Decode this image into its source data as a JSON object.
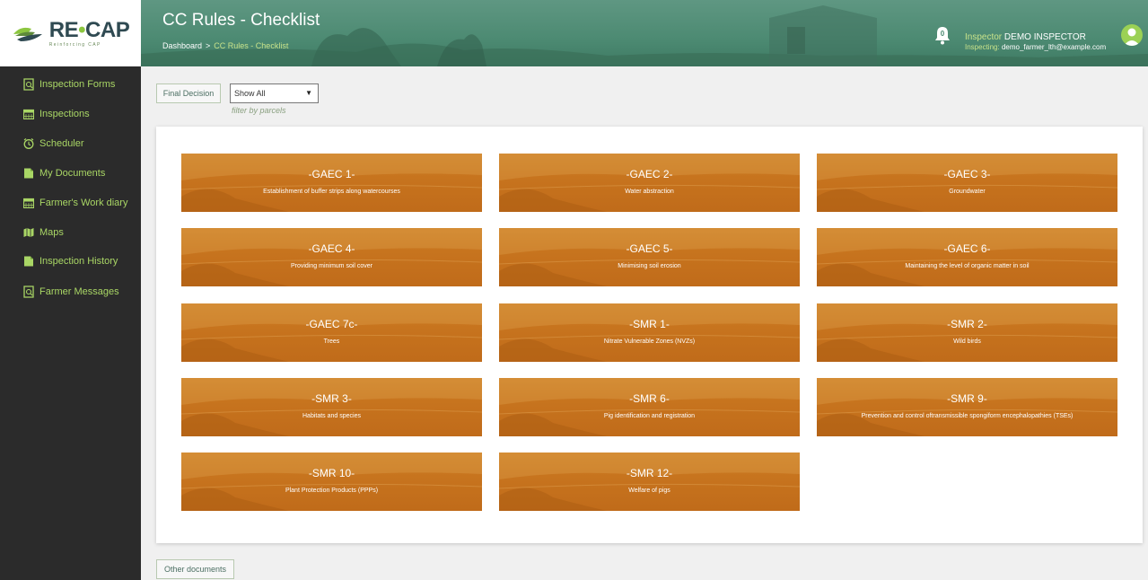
{
  "app": {
    "logo_text_main": "RE",
    "logo_text_dot": "•",
    "logo_text_end": "CAP",
    "logo_sub": "Reinforcing CAP"
  },
  "header": {
    "title": "CC Rules - Checklist",
    "breadcrumb": {
      "root": "Dashboard",
      "separator": ">",
      "current": "CC Rules - Checklist"
    },
    "notifications_count": "0",
    "user_role": "Inspector",
    "user_name": "DEMO INSPECTOR",
    "inspecting_label": "Inspecting:",
    "inspecting_value": "demo_farmer_lth@example.com"
  },
  "sidebar": {
    "items": [
      {
        "label": "Inspection Forms",
        "icon": "form-icon"
      },
      {
        "label": "Inspections",
        "icon": "calendar-icon"
      },
      {
        "label": "Scheduler",
        "icon": "clock-icon"
      },
      {
        "label": "My Documents",
        "icon": "document-icon"
      },
      {
        "label": "Farmer's Work diary",
        "icon": "calendar-icon"
      },
      {
        "label": "Maps",
        "icon": "map-icon"
      },
      {
        "label": "Inspection History",
        "icon": "document-icon"
      },
      {
        "label": "Farmer Messages",
        "icon": "form-icon"
      }
    ]
  },
  "toolbar": {
    "final_decision_label": "Final Decision",
    "filter_selected": "Show All",
    "filter_hint": "filter by parcels"
  },
  "rules": [
    {
      "code": "-GAEC 1-",
      "desc": "Establishment of buffer strips along watercourses"
    },
    {
      "code": "-GAEC 2-",
      "desc": "Water abstraction"
    },
    {
      "code": "-GAEC 3-",
      "desc": "Groundwater"
    },
    {
      "code": "-GAEC 4-",
      "desc": "Providing minimum soil cover"
    },
    {
      "code": "-GAEC 5-",
      "desc": "Minimising soil erosion"
    },
    {
      "code": "-GAEC 6-",
      "desc": "Maintaining the level of organic matter in soil"
    },
    {
      "code": "-GAEC 7c-",
      "desc": "Trees"
    },
    {
      "code": "-SMR 1-",
      "desc": "Nitrate Vulnerable Zones (NVZs)"
    },
    {
      "code": "-SMR 2-",
      "desc": "Wild birds"
    },
    {
      "code": "-SMR 3-",
      "desc": "Habitats and species"
    },
    {
      "code": "-SMR 6-",
      "desc": "Pig identification and registration"
    },
    {
      "code": "-SMR 9-",
      "desc": "Prevention and control oftransmissible spongiform encephalopathies (TSEs)"
    },
    {
      "code": "-SMR 10-",
      "desc": "Plant Protection Products (PPPs)"
    },
    {
      "code": "-SMR 12-",
      "desc": "Welfare of pigs"
    }
  ],
  "footer": {
    "other_documents_label": "Other documents"
  },
  "colors": {
    "header": "#4c8a72",
    "sidebar": "#2b2b2b",
    "accent": "#a9d665",
    "tile": "#c7741e"
  }
}
